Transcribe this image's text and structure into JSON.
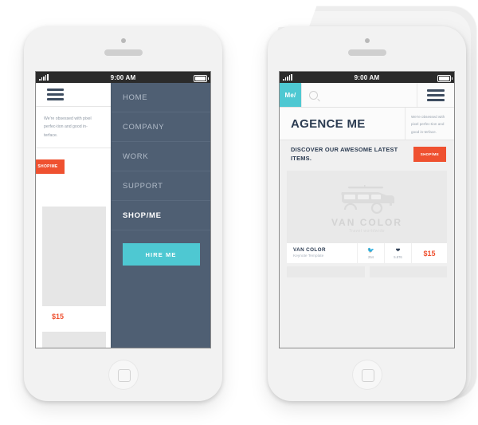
{
  "statusbar": {
    "time": "9:00 AM",
    "signal_icon": "signal-bars-icon",
    "battery_icon": "battery-icon"
  },
  "left_phone": {
    "menu_icon": "hamburger-menu-icon",
    "background_page": {
      "description": "We're obsessed with pixel perfec-tion and good in-terface.",
      "shop_button": "SHOP/ME",
      "price": "$15"
    },
    "menu": {
      "items": [
        {
          "label": "HOME",
          "active": false
        },
        {
          "label": "COMPANY",
          "active": false
        },
        {
          "label": "WORK",
          "active": false
        },
        {
          "label": "SUPPORT",
          "active": false
        },
        {
          "label": "SHOP/ME",
          "active": true
        }
      ],
      "cta_label": "HIRE ME"
    }
  },
  "right_phone": {
    "nav": {
      "logo": "Me/",
      "search_icon": "search-icon",
      "search_placeholder": "",
      "menu_icon": "hamburger-menu-icon"
    },
    "hero": {
      "title": "AGENCE ME",
      "description": "We're obsessed with pixel perfec-tion and good in-terface."
    },
    "promo": {
      "headline": "DISCOVER OUR AWESOME LATEST ITEMS.",
      "button": "SHOP/ME"
    },
    "product": {
      "artwork_icon": "van-illustration-icon",
      "artwork_title": "VAN COLOR",
      "artwork_subtitle": "Travel worldwide",
      "title": "VAN COLOR",
      "subtitle": "Keynote Template",
      "tweet_icon": "twitter-bird-icon",
      "tweet_count": "254",
      "like_icon": "heart-icon",
      "like_count": "5.876",
      "price": "$15"
    }
  },
  "colors": {
    "navy": "#2c3c52",
    "slate": "#4f5f73",
    "teal": "#4ec8d2",
    "orange": "#ef5130",
    "page_bg": "#f0f0f0"
  }
}
